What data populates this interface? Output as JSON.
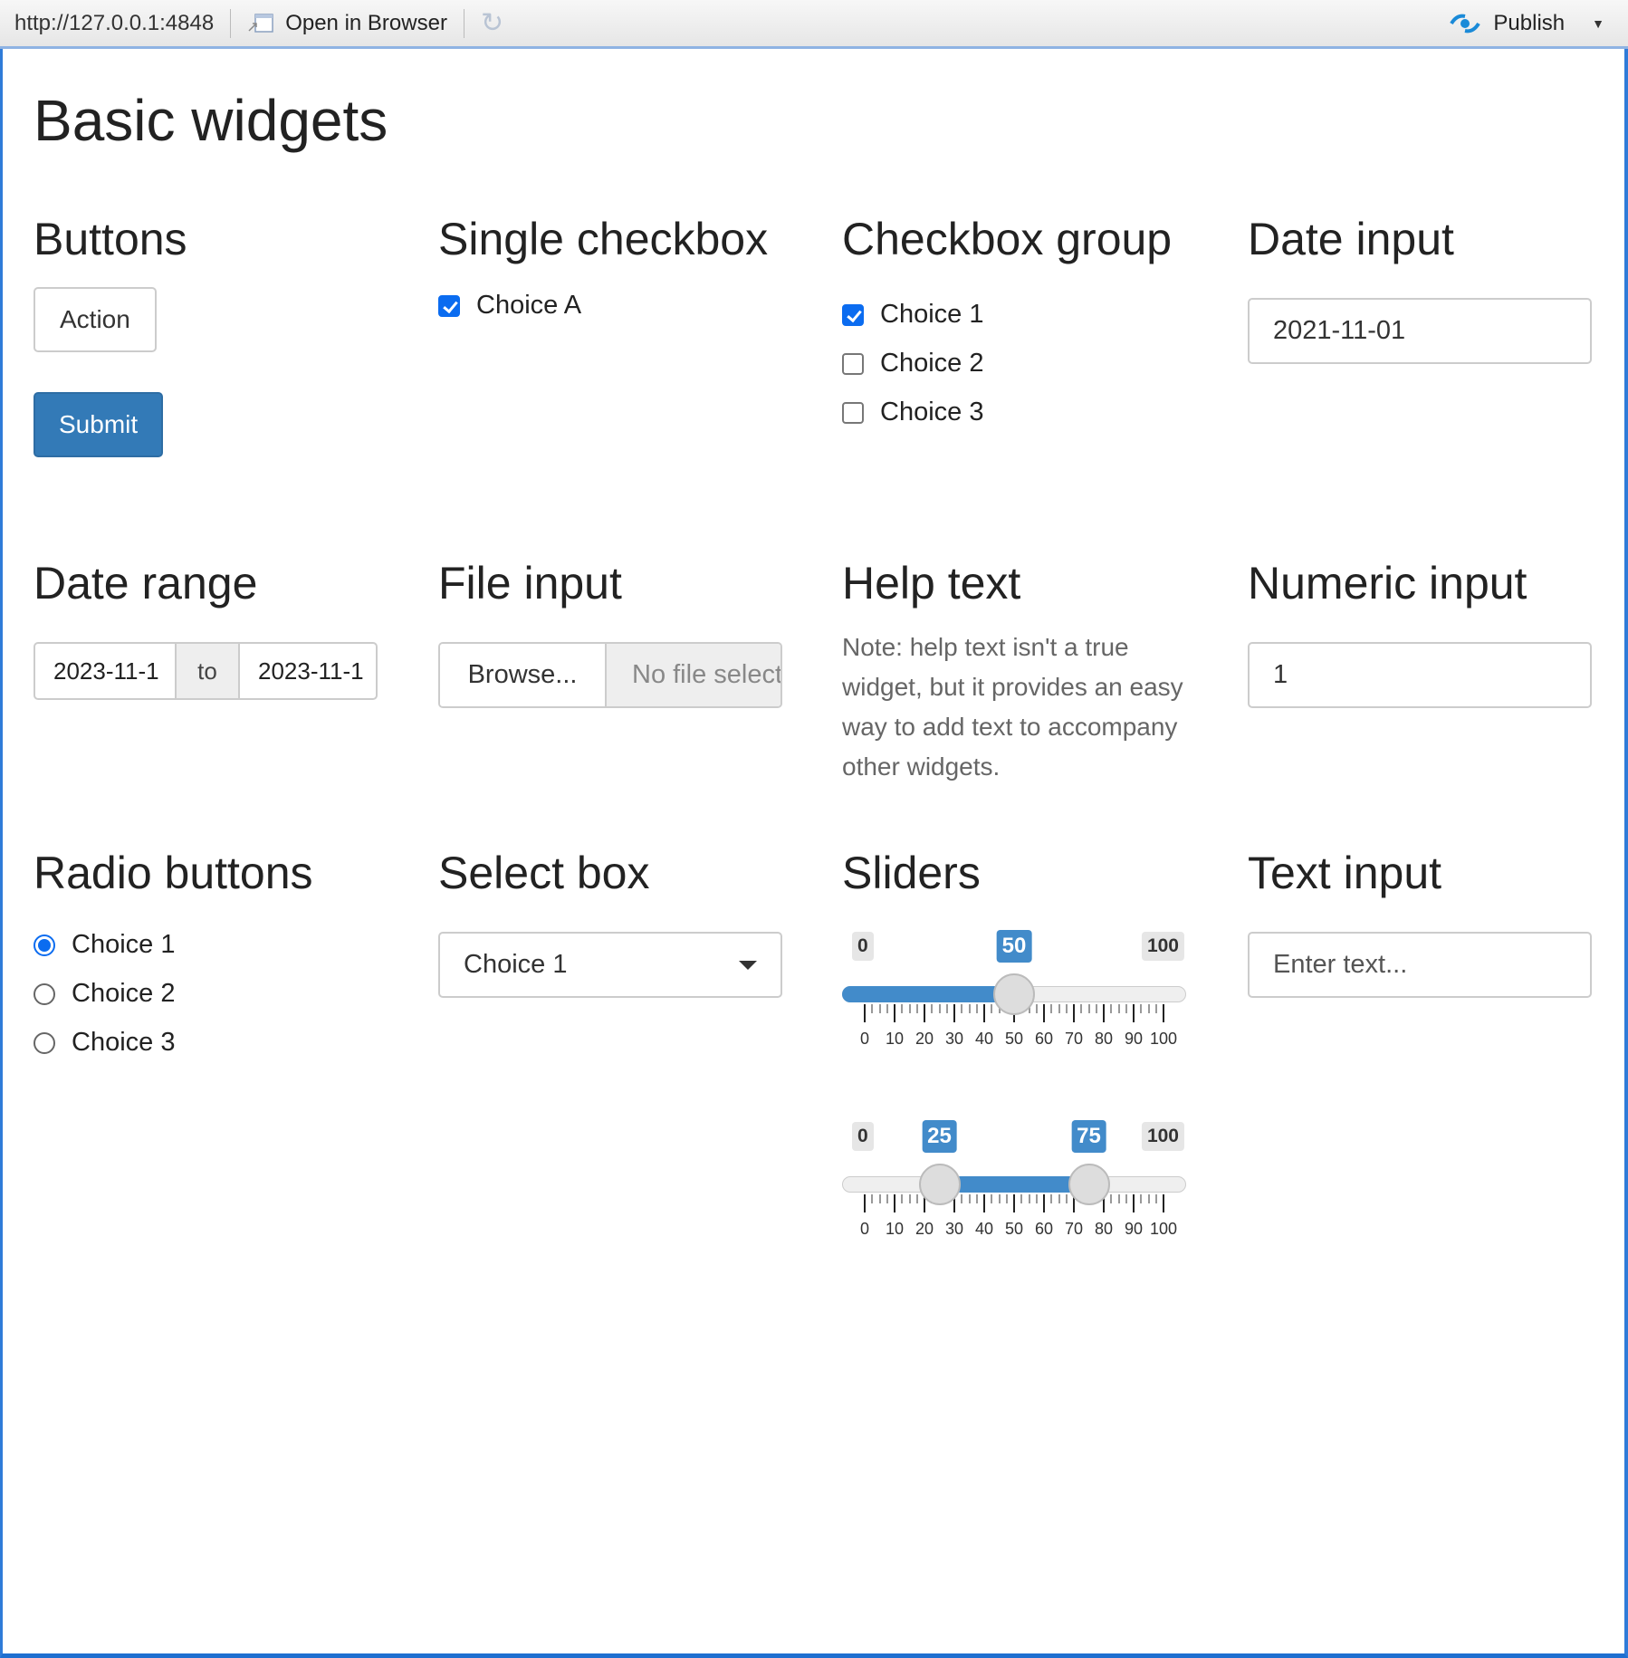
{
  "toolbar": {
    "url": "http://127.0.0.1:4848",
    "open_in_browser": "Open in Browser",
    "refresh_icon": "refresh-icon",
    "publish": "Publish",
    "publish_icon": "publish-icon",
    "publish_menu_icon": "caret-down-icon"
  },
  "page": {
    "title": "Basic widgets"
  },
  "buttons": {
    "heading": "Buttons",
    "action": "Action",
    "submit": "Submit"
  },
  "single_checkbox": {
    "heading": "Single checkbox",
    "label": "Choice A",
    "checked": true
  },
  "checkbox_group": {
    "heading": "Checkbox group",
    "options": [
      {
        "label": "Choice 1",
        "checked": true
      },
      {
        "label": "Choice 2",
        "checked": false
      },
      {
        "label": "Choice 3",
        "checked": false
      }
    ]
  },
  "date_input": {
    "heading": "Date input",
    "value": "2021-11-01"
  },
  "date_range": {
    "heading": "Date range",
    "start": "2023-11-1",
    "separator": "to",
    "end": "2023-11-1"
  },
  "file_input": {
    "heading": "File input",
    "browse": "Browse...",
    "status": "No file selected"
  },
  "help_text": {
    "heading": "Help text",
    "text": "Note: help text isn't a true widget, but it provides an easy way to add text to accompany other widgets."
  },
  "numeric_input": {
    "heading": "Numeric input",
    "value": "1"
  },
  "radio_buttons": {
    "heading": "Radio buttons",
    "options": [
      {
        "label": "Choice 1",
        "selected": true
      },
      {
        "label": "Choice 2",
        "selected": false
      },
      {
        "label": "Choice 3",
        "selected": false
      }
    ]
  },
  "select_box": {
    "heading": "Select box",
    "selected": "Choice 1"
  },
  "sliders": {
    "heading": "Sliders",
    "min": 0,
    "max": 100,
    "min_label": "0",
    "max_label": "100",
    "tick_labels": [
      "0",
      "10",
      "20",
      "30",
      "40",
      "50",
      "60",
      "70",
      "80",
      "90",
      "100"
    ],
    "single": {
      "value": 50,
      "value_label": "50"
    },
    "range": {
      "low": 25,
      "high": 75,
      "low_label": "25",
      "high_label": "75"
    }
  },
  "text_input": {
    "heading": "Text input",
    "placeholder": "Enter text..."
  },
  "colors": {
    "primary": "#337ab7",
    "slider": "#428bca",
    "checkbox": "#0b6cf0",
    "frame": "#2f7bd8"
  }
}
